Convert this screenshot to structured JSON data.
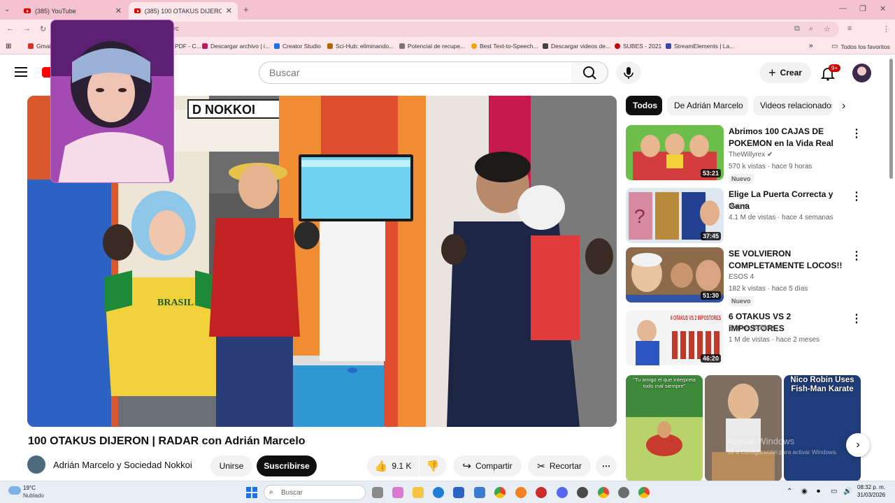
{
  "browser": {
    "tabs": [
      {
        "label": "(385) YouTube"
      },
      {
        "label": "(385) 100 OTAKUS DIJERON | RA"
      }
    ],
    "url_fragment": "yc",
    "bookmarks": [
      "Gmail",
      "PDF - C...",
      "Descargar archivo | i...",
      "Creator Studio",
      "Sci-Hub: eliminando...",
      "Potencial de recupe...",
      "Best Text-to-Speech...",
      "Descargar videos de...",
      "SUBES - 2021",
      "StreamElements | La..."
    ],
    "all_favorites": "Todos los favoritos"
  },
  "youtube": {
    "search_placeholder": "Buscar",
    "create_label": "Crear",
    "notif_badge": "9+",
    "video": {
      "title": "100 OTAKUS DIJERON | RADAR con Adrián Marcelo",
      "channel": "Adrián Marcelo y Sociedad Nokkoi",
      "join_label": "Unirse",
      "subscribe_label": "Suscribirse",
      "likes": "9.1 K",
      "share_label": "Compartir",
      "clip_label": "Recortar",
      "shirt_text": "BRASIL",
      "booth_text": "D NOKKOI"
    },
    "chips": [
      "Todos",
      "De Adrián Marcelo",
      "Videos relacionados"
    ],
    "recommendations": [
      {
        "title": "Abrimos 100 CAJAS DE POKEMON en la Vida Real",
        "channel": "TheWillyrex",
        "meta": "570 k vistas · hace 9 horas",
        "badge": "Nuevo",
        "duration": "53:21",
        "verified": true
      },
      {
        "title": "Elige La Puerta Correcta y Gana",
        "channel": "Ibai",
        "meta": "4.1 M de vistas · hace 4 semanas",
        "badge": "",
        "duration": "37:45",
        "verified": true
      },
      {
        "title": "SE VOLVIERON COMPLETAMENTE LOCOS!!",
        "channel": "ESOS 4",
        "meta": "182 k vistas · hace 5 días",
        "badge": "Nuevo",
        "duration": "51:30",
        "verified": false
      },
      {
        "title": "6 OTAKUS VS 2 IMPOSTORES",
        "channel": "Somos Bubble",
        "meta": "1 M de vistas · hace 2 meses",
        "badge": "",
        "duration": "46:20",
        "verified": false
      }
    ],
    "shorts": [
      {
        "caption": "\"Tu amigo el que interpreta todo mal siempre\""
      },
      {
        "caption": ""
      },
      {
        "caption": "Nico Robin Uses Fish-Man Karate"
      }
    ],
    "activate_windows": [
      "Activar Windows",
      "Ve a Configuración para activar Windows."
    ],
    "thumb_text_4": "6 OTAKUS VS 2 IMPOSTORES"
  },
  "taskbar": {
    "weather_temp": "19°C",
    "weather_desc": "Nublado",
    "search_placeholder": "Buscar",
    "time": "08:32 p. m.",
    "date": "31/03/2026"
  }
}
